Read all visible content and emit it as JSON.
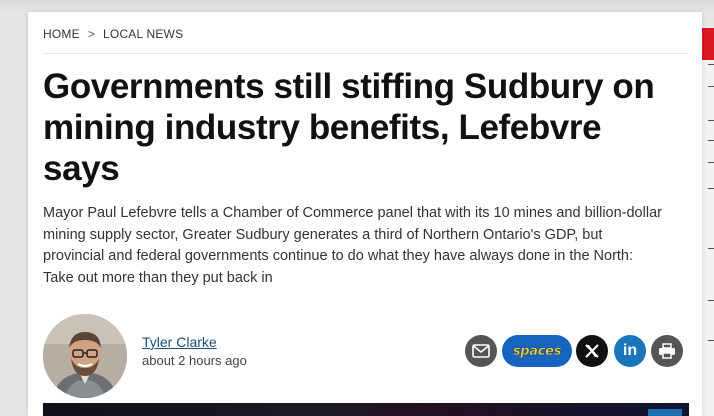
{
  "breadcrumb": {
    "home": "HOME",
    "separator": ">",
    "section": "LOCAL NEWS"
  },
  "article": {
    "headline": "Governments still stiffing Sudbury on mining industry benefits, Lefebvre says",
    "dek": "Mayor Paul Lefebvre tells a Chamber of Commerce panel that with its 10 mines and billion-dollar mining supply sector, Greater Sudbury generates a third of Northern Ontario's GDP, but provincial and federal governments continue to do what they have always done in the North: Take out more than they put back in"
  },
  "byline": {
    "author": "Tyler Clarke",
    "time": "about 2 hours ago"
  },
  "share": {
    "spaces_label": "spaces",
    "linkedin_label": "in",
    "icons": [
      "email-icon",
      "spaces-logo",
      "x-icon",
      "linkedin-icon",
      "print-icon"
    ]
  },
  "colors": {
    "link": "#1a4f7a",
    "share_grey": "#555555",
    "spaces_blue": "#1565c0",
    "linkedin_blue": "#1b75bb",
    "ad_red": "#d71920"
  }
}
